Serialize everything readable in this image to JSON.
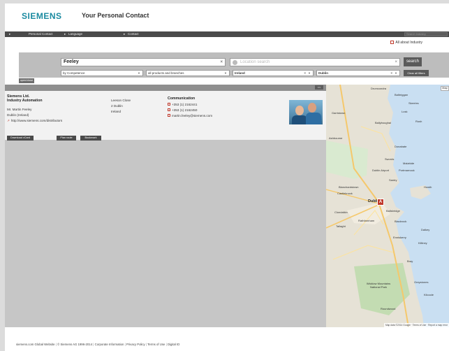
{
  "header": {
    "logo": "SIEMENS",
    "title": "Your Personal Contact"
  },
  "nav": {
    "items": [
      "Personal Contact",
      "Language",
      "Contact"
    ],
    "search_placeholder": "Search industry"
  },
  "industry_link": "All about Industry",
  "search": {
    "keyword": "Feeley",
    "location_placeholder": "Location search",
    "search_button": "search",
    "clear_button": "Clear all filters",
    "filters": [
      "by Competence",
      "all products and branches",
      "Ireland",
      "Dublin"
    ]
  },
  "openclose_label": "open/close",
  "collapse_label": "<<",
  "result": {
    "company": "Siemens Ltd.",
    "division": "Industry Automation",
    "name": "Mr. Martin Feeley",
    "city": "Dublin (Ireland)",
    "url": "http://www.siemens.com/distributors",
    "address": [
      "Leeson Close",
      "2 Dublin",
      "Ireland"
    ],
    "comm_title": "Communication",
    "phone": "+353 (1) 2162441",
    "fax": "+353 (1) 2162450",
    "email": "martin.feeley@siemens.com",
    "buttons": [
      "Download vCard",
      "Plan route",
      "Bookmark"
    ]
  },
  "map": {
    "satellite_label": "Map",
    "center_label": "Dublin",
    "labels": [
      "Drumcondra",
      "Balbriggan",
      "Skerries",
      "Garristown",
      "Ballyboughal",
      "Lusk",
      "Rush",
      "Ashbourne",
      "Donabate",
      "Swords",
      "Malahide",
      "Dublin Airport",
      "Portmarnock",
      "Blanchardstown",
      "Santry",
      "Howth",
      "Castleknock",
      "Clondalkin",
      "Ballsbridge",
      "Tallaght",
      "Blackrock",
      "Dalkey",
      "Killiney",
      "Bray",
      "Greystones",
      "Kilcoole",
      "Wicklow Mountains National Park",
      "Roundwood",
      "Enniskerry",
      "Rathfarnham"
    ],
    "footer": "Map data ©2014 Google · Terms of Use · Report a map error"
  },
  "footer": {
    "items": [
      "siemens.com Global Website",
      "© Siemens AG 1996-2014",
      "Corporate Information",
      "Privacy Policy",
      "Terms of Use",
      "Digital ID"
    ]
  }
}
